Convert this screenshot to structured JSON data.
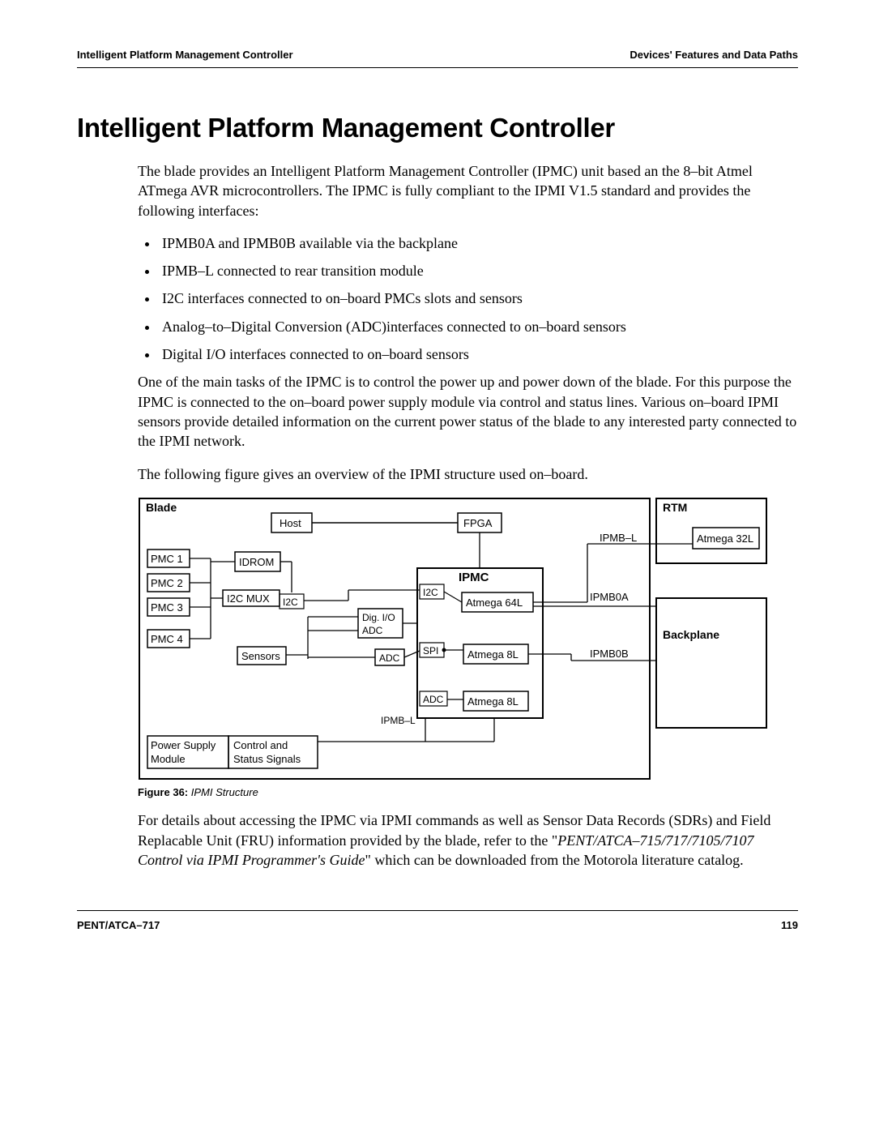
{
  "header": {
    "left": "Intelligent Platform Management Controller",
    "right": "Devices' Features and Data Paths"
  },
  "title": "Intelligent Platform Management Controller",
  "intro": "The blade provides an Intelligent Platform Management Controller (IPMC) unit based an the 8–bit Atmel ATmega AVR microcontrollers. The IPMC is fully compliant to the IPMI V1.5 standard and provides the following interfaces:",
  "bullets": [
    "IPMB0A and IPMB0B available via the backplane",
    "IPMB–L connected to rear transition module",
    "I2C interfaces connected to on–board PMCs slots and sensors",
    "Analog–to–Digital Conversion (ADC)interfaces connected to on–board sensors",
    "Digital I/O interfaces connected to on–board sensors"
  ],
  "para2": "One of the main tasks of the IPMC is to control the power up and power down of the blade. For this purpose the IPMC is connected to the on–board power supply module via control and status lines. Various on–board IPMI sensors provide detailed information on the current power status of the blade to any interested party connected to the IPMI network.",
  "para3": "The following figure gives an overview of the IPMI structure used on–board.",
  "diagram": {
    "blade": "Blade",
    "rtm": "RTM",
    "host": "Host",
    "fpga": "FPGA",
    "idrom": "IDROM",
    "pmc1": "PMC 1",
    "pmc2": "PMC 2",
    "pmc3": "PMC 3",
    "pmc4": "PMC 4",
    "i2cmux": "I2C MUX",
    "i2c_small": "I2C",
    "sensors": "Sensors",
    "digio": "Dig. I/O",
    "adc": "ADC",
    "spi": "SPI",
    "ipmc_title": "IPMC",
    "i2c": "I2C",
    "atmega64": "Atmega 64L",
    "atmega8_1": "Atmega 8L",
    "atmega8_2": "Atmega 8L",
    "ipmb_l": "IPMB–L",
    "ipmb0a": "IPMB0A",
    "ipmb0b": "IPMB0B",
    "atmega32": "Atmega 32L",
    "backplane": "Backplane",
    "powersupply1": "Power Supply",
    "powersupply2": "Module",
    "control1": "Control and",
    "control2": "Status Signals"
  },
  "figure_label": "Figure 36:",
  "figure_title": " IPMI Structure",
  "para4_a": "For details about accessing the IPMC via IPMI commands as well as Sensor Data Records (SDRs) and Field Replacable Unit (FRU) information provided by the blade, refer to the \"",
  "para4_italic": "PENT/ATCA–715/717/7105/7107 Control via IPMI Programmer's Guide",
  "para4_b": "\" which can be downloaded from the Motorola literature catalog.",
  "footer": {
    "left": "PENT/ATCA–717",
    "right": "119"
  }
}
